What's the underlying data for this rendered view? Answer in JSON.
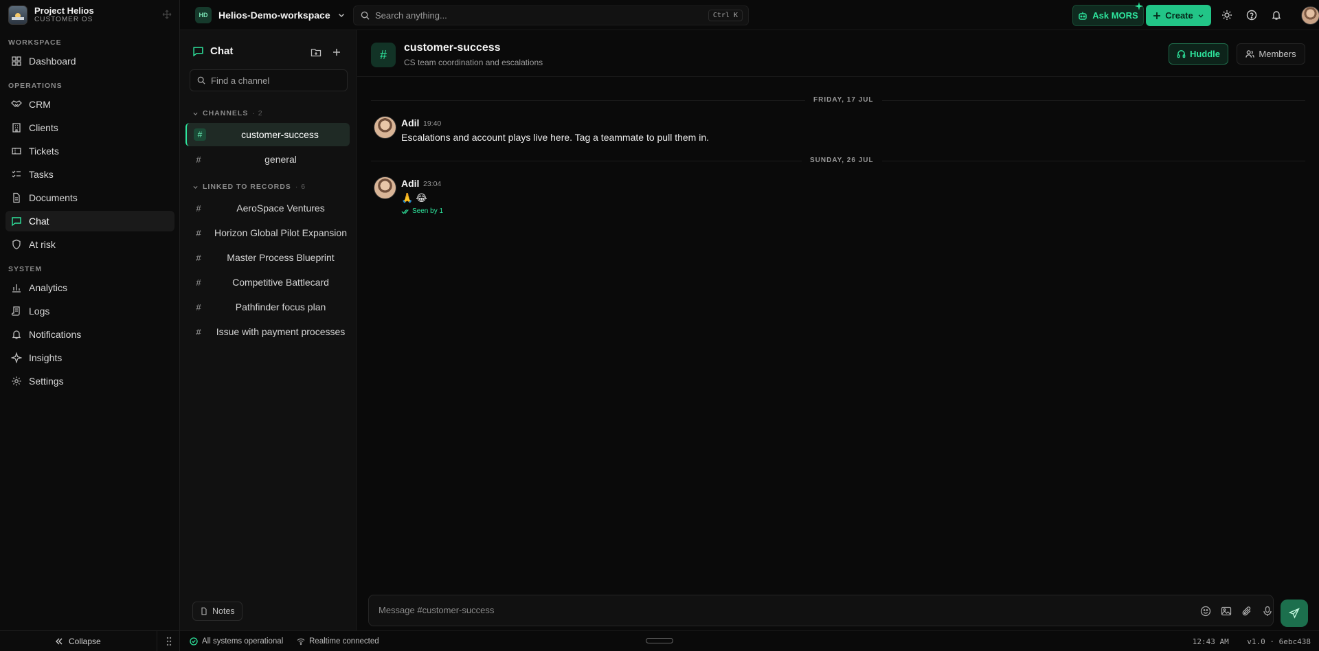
{
  "brand": {
    "title": "Project Helios",
    "subtitle": "CUSTOMER OS"
  },
  "sidebar": {
    "sections": [
      {
        "label": "WORKSPACE",
        "items": [
          {
            "label": "Dashboard",
            "icon": "dashboard-icon"
          }
        ]
      },
      {
        "label": "OPERATIONS",
        "items": [
          {
            "label": "CRM",
            "icon": "handshake-icon"
          },
          {
            "label": "Clients",
            "icon": "building-icon"
          },
          {
            "label": "Tickets",
            "icon": "ticket-icon"
          },
          {
            "label": "Tasks",
            "icon": "checklist-icon"
          },
          {
            "label": "Documents",
            "icon": "document-icon"
          },
          {
            "label": "Chat",
            "icon": "chat-icon",
            "active": true
          },
          {
            "label": "At risk",
            "icon": "shield-icon"
          }
        ]
      },
      {
        "label": "SYSTEM",
        "items": [
          {
            "label": "Analytics",
            "icon": "bar-chart-icon"
          },
          {
            "label": "Logs",
            "icon": "scroll-icon"
          },
          {
            "label": "Notifications",
            "icon": "bell-icon"
          },
          {
            "label": "Insights",
            "icon": "sparkle-icon"
          },
          {
            "label": "Settings",
            "icon": "gear-icon"
          }
        ]
      }
    ],
    "collapse_label": "Collapse"
  },
  "topbar": {
    "workspace_badge": "HD",
    "workspace_name": "Helios-Demo-workspace",
    "search_placeholder": "Search anything...",
    "search_shortcut": "Ctrl K",
    "ask_label": "Ask MORS",
    "create_label": "Create"
  },
  "channels": {
    "title": "Chat",
    "find_placeholder": "Find a channel",
    "groups": [
      {
        "label": "CHANNELS",
        "count": "2",
        "items": [
          {
            "label": "customer-success",
            "active": true
          },
          {
            "label": "general"
          }
        ]
      },
      {
        "label": "LINKED TO RECORDS",
        "count": "6",
        "items": [
          {
            "label": "AeroSpace Ventures"
          },
          {
            "label": "Horizon Global Pilot Expansion"
          },
          {
            "label": "Master Process Blueprint"
          },
          {
            "label": "Competitive Battlecard"
          },
          {
            "label": "Pathfinder focus plan"
          },
          {
            "label": "Issue with payment processes"
          }
        ]
      }
    ],
    "notes_label": "Notes"
  },
  "main": {
    "channel_name": "customer-success",
    "channel_desc": "CS team coordination and escalations",
    "huddle_label": "Huddle",
    "members_label": "Members",
    "days": [
      {
        "label": "FRIDAY, 17 JUL",
        "message": {
          "author": "Adil",
          "time": "19:40",
          "text": "Escalations and account plays live here. Tag a teammate to pull them in."
        }
      },
      {
        "label": "SUNDAY, 26 JUL",
        "message": {
          "author": "Adil",
          "time": "23:04",
          "text": "🙏 😂",
          "seen": "Seen by 1"
        }
      }
    ],
    "composer_placeholder": "Message #customer-success"
  },
  "status": {
    "systems": "All systems operational",
    "realtime": "Realtime connected",
    "clock": "12:43 AM",
    "version": "v1.0 · 6ebc438"
  },
  "colors": {
    "accent": "#2ee59d",
    "background": "#0a0a0a",
    "panel": "#111111"
  }
}
